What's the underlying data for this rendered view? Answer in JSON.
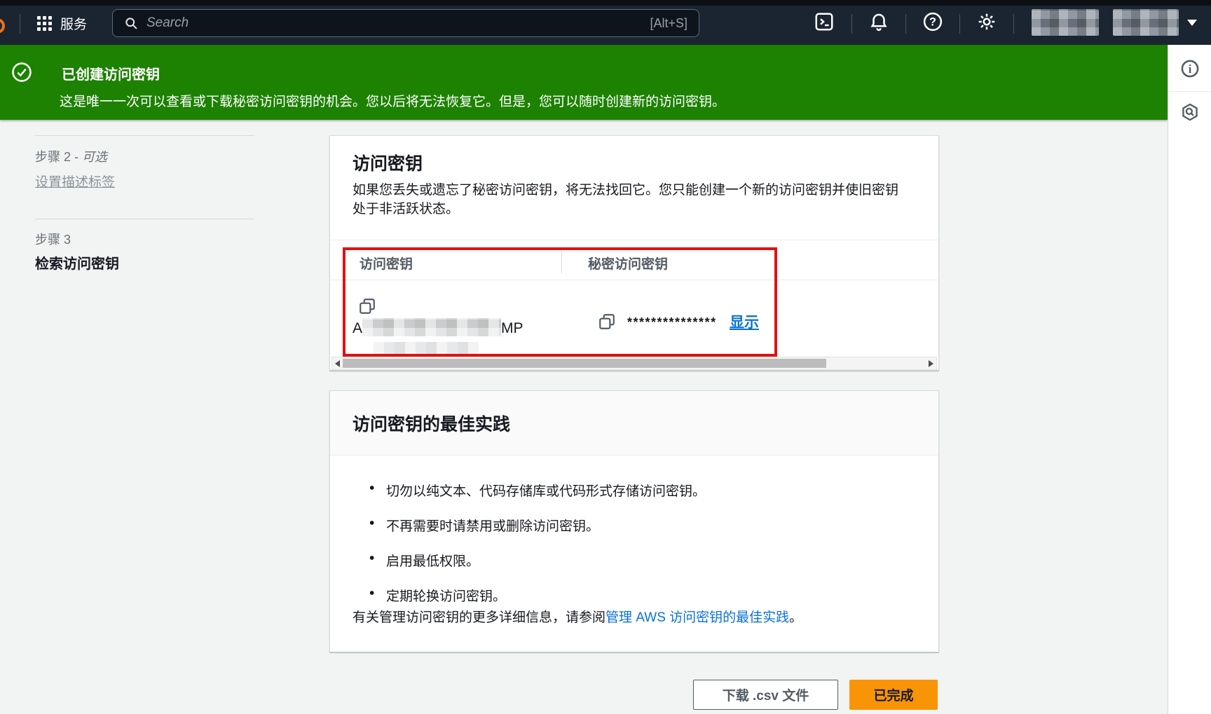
{
  "topbar": {
    "services_label": "服务",
    "search_placeholder": "Search",
    "search_shortcut": "[Alt+S]"
  },
  "banner": {
    "title": "已创建访问密钥",
    "message": "这是唯一一次可以查看或下载秘密访问密钥的机会。您以后将无法恢复它。但是，您可以随时创建新的访问密钥。",
    "color": "#1d8102"
  },
  "sidebar": {
    "step2_prefix": "步骤 2 - ",
    "step2_optional": "可选",
    "step2_link": "设置描述标签",
    "step3_label": "步骤 3",
    "step3_title": "检索访问密钥"
  },
  "access_key_card": {
    "title": "访问密钥",
    "description": "如果您丢失或遗忘了秘密访问密钥，将无法找回它。您只能创建一个新的访问密钥并使旧密钥处于非活跃状态。",
    "table": {
      "col1_header": "访问密钥",
      "col2_header": "秘密访问密钥",
      "access_key_prefix": "A",
      "access_key_suffix": "MP",
      "secret_mask": "***************",
      "show_label": "显示"
    },
    "highlight_color": "#e01212"
  },
  "best_practices_card": {
    "title": "访问密钥的最佳实践",
    "bullets": [
      "切勿以纯文本、代码存储库或代码形式存储访问密钥。",
      "不再需要时请禁用或删除访问密钥。",
      "启用最低权限。",
      "定期轮换访问密钥。"
    ],
    "footer_prefix": "有关管理访问密钥的更多详细信息，请参阅",
    "footer_link": "管理 AWS 访问密钥的最佳实践",
    "footer_suffix": "。",
    "link_color": "#0972d3"
  },
  "actions": {
    "download_csv": "下载 .csv 文件",
    "done": "已完成",
    "done_color": "#f89406"
  }
}
